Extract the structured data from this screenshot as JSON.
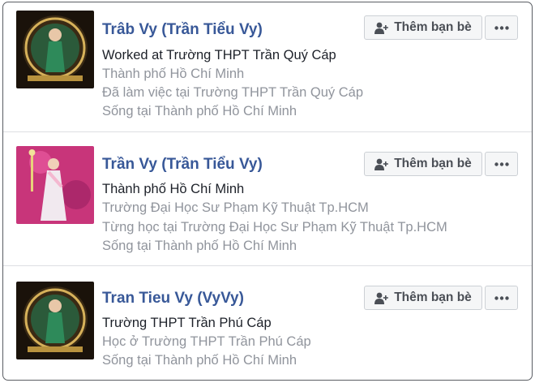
{
  "add_friend_label": "Thêm bạn bè",
  "more_icon": "ellipsis-icon",
  "add_icon": "add-friend-icon",
  "colors": {
    "name_link": "#385898",
    "secondary_text": "#90949c",
    "primary_text": "#1d2129"
  },
  "results": [
    {
      "name": "Trâb Vy (Trần Tiểu Vy)",
      "lines": [
        {
          "text": "Worked at Trường THPT Trần Quý Cáp",
          "style": "primary"
        },
        {
          "text": "Thành phố Hồ Chí Minh",
          "style": "secondary"
        },
        {
          "text": "Đã làm việc tại Trường THPT Trần Quý Cáp",
          "style": "secondary"
        },
        {
          "text": "Sống tại Thành phố Hồ Chí Minh",
          "style": "secondary"
        }
      ]
    },
    {
      "name": "Trần Vy (Trần Tiểu Vy)",
      "lines": [
        {
          "text": "Thành phố Hồ Chí Minh",
          "style": "primary"
        },
        {
          "text": "Trường Đại Học Sư Phạm Kỹ Thuật Tp.HCM",
          "style": "secondary"
        },
        {
          "text": "Từng học tại Trường Đại Học Sư Phạm Kỹ Thuật Tp.HCM",
          "style": "secondary"
        },
        {
          "text": "Sống tại Thành phố Hồ Chí Minh",
          "style": "secondary"
        }
      ]
    },
    {
      "name": "Tran Tieu Vy (VyVy)",
      "lines": [
        {
          "text": "Trường THPT Trần Phú Cáp",
          "style": "primary"
        },
        {
          "text": "Học ở Trường THPT Trần Phú Cáp",
          "style": "secondary"
        },
        {
          "text": "Sống tại Thành phố Hồ Chí Minh",
          "style": "secondary"
        }
      ]
    }
  ]
}
